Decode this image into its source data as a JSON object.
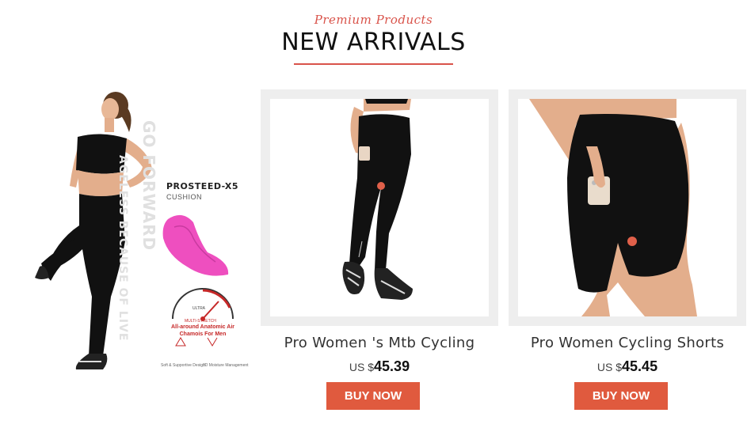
{
  "header": {
    "subtitle": "Premium Products",
    "title": "NEW ARRIVALS",
    "accent_color": "#d9534a"
  },
  "promo": {
    "brand": "PROSTEED-X5",
    "brand_sub": "CUSHION",
    "vertical_text_1": "GO FORWARD",
    "vertical_text_2": "AGELESS BECAUSE OF LIVE",
    "chamois_caption": "All-around Anatomic Air Chamois For Men",
    "footnote_left": "Soft & Supportive Design",
    "footnote_right": "3D Moisture Management",
    "gauge_label": "ULTRA",
    "gauge_sub": "MULTI-STRETCH"
  },
  "products": [
    {
      "name": "Pro Women 's Mtb Cycling",
      "currency": "US $",
      "price": "45.39",
      "button": "BUY NOW"
    },
    {
      "name": "Pro Women Cycling Shorts",
      "currency": "US $",
      "price": "45.45",
      "button": "BUY NOW"
    }
  ],
  "colors": {
    "button": "#e05a3e",
    "chamois": "#ee4fbf",
    "card_frame": "#eeeeee"
  }
}
